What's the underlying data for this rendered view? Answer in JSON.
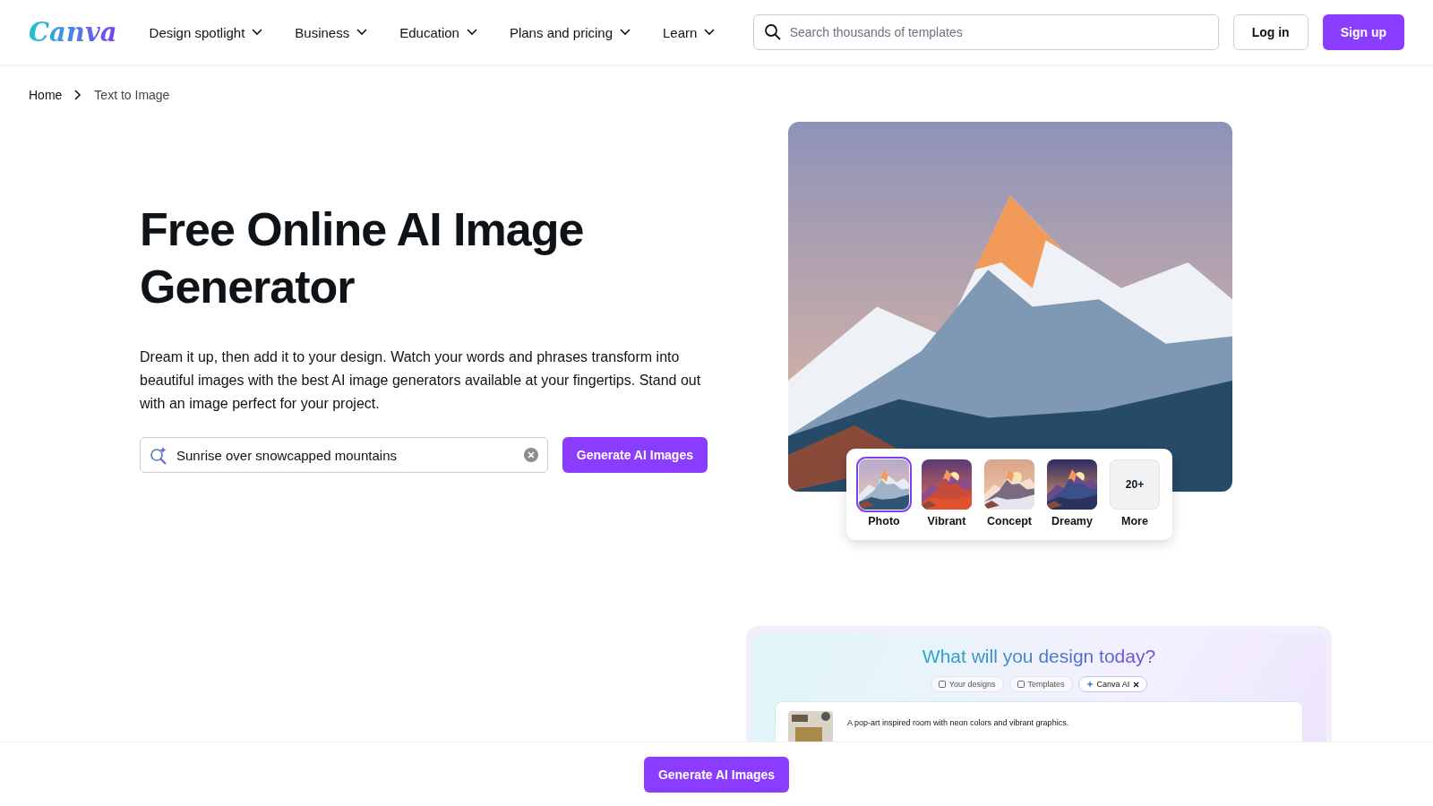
{
  "header": {
    "logo": "Canva",
    "nav": [
      {
        "label": "Design spotlight"
      },
      {
        "label": "Business"
      },
      {
        "label": "Education"
      },
      {
        "label": "Plans and pricing"
      },
      {
        "label": "Learn"
      }
    ],
    "search": {
      "placeholder": "Search thousands of templates"
    },
    "buttons": [
      {
        "label": "Log in",
        "kind": "outline"
      },
      {
        "label": "Sign up",
        "kind": "primary"
      }
    ]
  },
  "breadcrumb": [
    "Home",
    "Text to Image"
  ],
  "hero": {
    "title": "Free Online AI Image Generator",
    "description": "Dream it up, then add it to your design. Watch your words and phrases transform into beautiful images with the best AI image generators available at your fingertips. Stand out with an image perfect for your project.",
    "prompt": {
      "value": "Sunrise over snowcapped mountains"
    },
    "button": "Generate AI Images",
    "styles": [
      {
        "kind": "picture",
        "label": "Photo",
        "selected": true
      },
      {
        "kind": "picture",
        "label": "Vibrant",
        "selected": false
      },
      {
        "kind": "picture",
        "label": "Concept",
        "selected": false
      },
      {
        "kind": "picture",
        "label": "Dreamy",
        "selected": false
      },
      {
        "kind": "more",
        "badge": "20+",
        "label": "More",
        "selected": false
      }
    ]
  },
  "preview": {
    "title": "What will you design today?",
    "chips": [
      {
        "label": "Your designs",
        "selected": false
      },
      {
        "label": "Templates",
        "selected": false
      },
      {
        "label": "Canva AI",
        "selected": true
      }
    ],
    "prompt": "A pop-art inspired room with neon colors and vibrant graphics."
  },
  "sticky_bar": {
    "button": "Generate AI Images"
  }
}
